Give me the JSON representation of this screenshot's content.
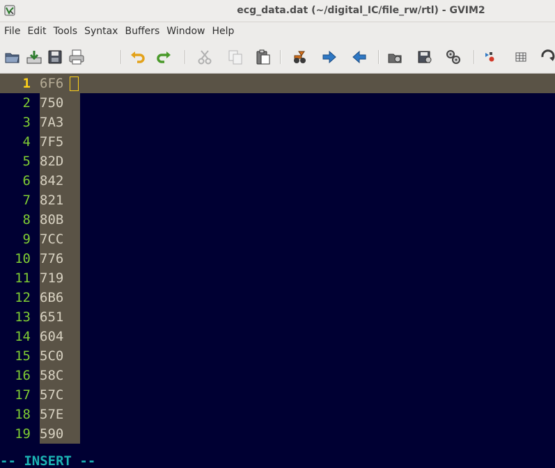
{
  "window": {
    "title": "ecg_data.dat (~/digital_IC/file_rw/rtl) - GVIM2",
    "app_icon": "gvim-icon"
  },
  "menu": {
    "items": [
      "File",
      "Edit",
      "Tools",
      "Syntax",
      "Buffers",
      "Window",
      "Help"
    ]
  },
  "toolbar": {
    "icons": [
      "open-file-icon",
      "save-icon",
      "save-all-icon",
      "print-icon",
      "undo-icon",
      "redo-icon",
      "cut-icon",
      "copy-icon",
      "paste-icon",
      "find-replace-icon",
      "find-next-icon",
      "find-previous-icon",
      "load-session-icon",
      "save-session-icon",
      "run-script-icon",
      "make-icon",
      "run-ctags-icon",
      "jump-tag-icon"
    ]
  },
  "editor": {
    "lines": [
      {
        "num": "1",
        "text": "6F6"
      },
      {
        "num": "2",
        "text": "750"
      },
      {
        "num": "3",
        "text": "7A3"
      },
      {
        "num": "4",
        "text": "7F5"
      },
      {
        "num": "5",
        "text": "82D"
      },
      {
        "num": "6",
        "text": "842"
      },
      {
        "num": "7",
        "text": "821"
      },
      {
        "num": "8",
        "text": "80B"
      },
      {
        "num": "9",
        "text": "7CC"
      },
      {
        "num": "10",
        "text": "776"
      },
      {
        "num": "11",
        "text": "719"
      },
      {
        "num": "12",
        "text": "6B6"
      },
      {
        "num": "13",
        "text": "651"
      },
      {
        "num": "14",
        "text": "604"
      },
      {
        "num": "15",
        "text": "5C0"
      },
      {
        "num": "16",
        "text": "58C"
      },
      {
        "num": "17",
        "text": "57C"
      },
      {
        "num": "18",
        "text": "57E"
      },
      {
        "num": "19",
        "text": "590"
      }
    ],
    "current_line": 1
  },
  "status": {
    "mode": "-- INSERT --"
  },
  "colors": {
    "background": "#000033",
    "line_number": "#7fcc33",
    "current_line_number": "#ffd21a",
    "current_line_highlight": "#5a5346",
    "mode_text": "#1bb3b3"
  }
}
